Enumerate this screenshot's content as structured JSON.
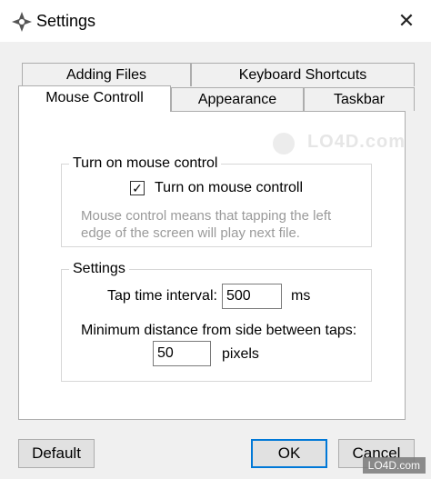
{
  "window": {
    "title": "Settings",
    "close_label": "✕"
  },
  "tabs": {
    "row_back": [
      {
        "label": "Adding Files"
      },
      {
        "label": "Keyboard Shortcuts"
      }
    ],
    "row_front": [
      {
        "label": "Mouse Controll",
        "active": true
      },
      {
        "label": "Appearance"
      },
      {
        "label": "Taskbar"
      }
    ]
  },
  "mouse_control_group": {
    "legend": "Turn on mouse control",
    "checkbox_label": "Turn on mouse controll",
    "checked": true,
    "checkmark": "✓",
    "description": "Mouse control means that tapping the left edge of the screen will play next file."
  },
  "settings_group": {
    "legend": "Settings",
    "tap_interval_label": "Tap time interval:",
    "tap_interval_value": "500",
    "tap_interval_unit": "ms",
    "min_distance_label": "Minimum distance from side between taps:",
    "min_distance_value": "50",
    "min_distance_unit": "pixels"
  },
  "buttons": {
    "default_label": "Default",
    "ok_label": "OK",
    "cancel_label": "Cancel"
  },
  "watermark": {
    "text": "LO4D.com",
    "footer": "LO4D.com"
  },
  "colors": {
    "accent": "#0078d7",
    "window_bg": "#f0f0f0",
    "panel_bg": "#ffffff"
  }
}
